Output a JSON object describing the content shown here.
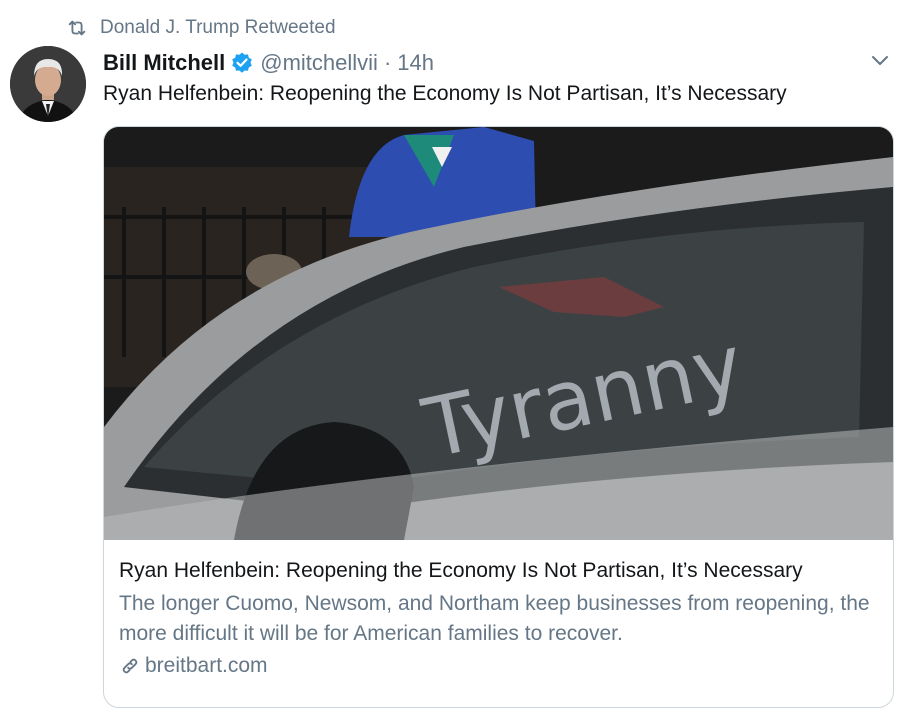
{
  "retweet": {
    "text": "Donald J. Trump Retweeted",
    "icon": "retweet-icon"
  },
  "author": {
    "name": "Bill Mitchell",
    "handle": "@mitchellvii",
    "separator": "·",
    "time": "14h",
    "verified": true
  },
  "tweet": {
    "text": "Ryan Helfenbein: Reopening the Economy Is Not Partisan, It’s Necessary"
  },
  "card": {
    "title": "Ryan Helfenbein: Reopening the Economy Is Not Partisan, It’s Necessary",
    "description": "The longer Cuomo, Newsom, and Northam keep businesses from reopening, the more difficult it will be for American families to recover.",
    "domain": "breitbart.com",
    "image_text": "Tyranny"
  },
  "colors": {
    "accent": "#1da1f2",
    "secondary_text": "#657786",
    "border": "#ccd6dd"
  }
}
